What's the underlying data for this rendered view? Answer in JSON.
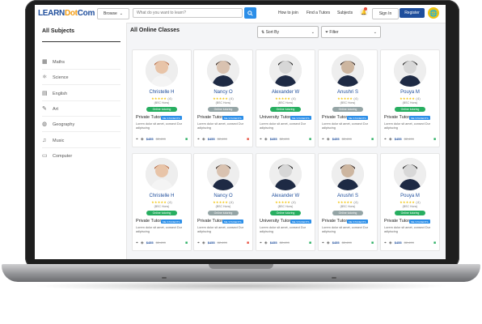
{
  "nav": {
    "logo_a": "LEARN",
    "logo_b": "Dot",
    "logo_c": "Com",
    "browse": "Browse",
    "search_placeholder": "What do you want to learn?",
    "links": [
      "How to join",
      "Find a Tutors",
      "Subjects"
    ],
    "signin": "Sign In",
    "register": "Register"
  },
  "sidebar": {
    "title": "All Subjects",
    "items": [
      {
        "label": "Maths",
        "icon": "calculator-icon"
      },
      {
        "label": "Science",
        "icon": "atom-icon"
      },
      {
        "label": "English",
        "icon": "book-icon"
      },
      {
        "label": "Art",
        "icon": "palette-icon"
      },
      {
        "label": "Geography",
        "icon": "globe-icon"
      },
      {
        "label": "Music",
        "icon": "music-note-icon"
      },
      {
        "label": "Computer",
        "icon": "monitor-icon"
      }
    ]
  },
  "main": {
    "title": "All Online Classes",
    "sort_label": "Sort By",
    "filter_label": "Filter"
  },
  "cards": [
    {
      "name": "Christelle H",
      "stars": "★★★★★",
      "score": "(4)",
      "loc": "(BSC Hons)",
      "mode": "Online tutoring",
      "mode_color": "#27ae60",
      "type": "Private Tutor",
      "badge": "ME STUDENTS",
      "desc": "Lorem dolor sit amet, consect Dur adipiscing",
      "price": "$455",
      "old": "$2,499"
    },
    {
      "name": "Nancy O",
      "stars": "★★★★★",
      "score": "(4)",
      "loc": "(BSC Hons)",
      "mode": "Online tutoring",
      "mode_color": "#95a5a6",
      "type": "Private Tutor",
      "badge": "ME STUDENTS",
      "desc": "Lorem dolor sit amet, consect Dur adipiscing",
      "price": "$455",
      "old": "$2,499"
    },
    {
      "name": "Alexander W",
      "stars": "★★★★★",
      "score": "(4)",
      "loc": "(BSC Hons)",
      "mode": "Online tutoring",
      "mode_color": "#27ae60",
      "type": "University Tutor",
      "badge": "ME STUDENTS",
      "desc": "Lorem dolor sit amet, consect Dur adipiscing",
      "price": "$455",
      "old": "$2,499"
    },
    {
      "name": "Anushri S",
      "stars": "★★★★★",
      "score": "(4)",
      "loc": "(BSC Hons)",
      "mode": "Online tutoring",
      "mode_color": "#95a5a6",
      "type": "Private Tutor",
      "badge": "ME STUDENTS",
      "desc": "Lorem dolor sit amet, consect Dur adipiscing",
      "price": "$455",
      "old": "$2,499"
    },
    {
      "name": "Pouya M",
      "stars": "★★★★★",
      "score": "(4)",
      "loc": "(BSC Hons)",
      "mode": "Online tutoring",
      "mode_color": "#27ae60",
      "type": "Private Tutor",
      "badge": "ME STUDENTS",
      "desc": "Lorem dolor sit amet, consect Dur adipiscing",
      "price": "$455",
      "old": "$2,499"
    },
    {
      "name": "Christelle H",
      "stars": "★★★★★",
      "score": "(4)",
      "loc": "(BSC Hons)",
      "mode": "Online tutoring",
      "mode_color": "#27ae60",
      "type": "Private Tutor",
      "badge": "ME STUDENTS",
      "desc": "Lorem dolor sit amet, consect Dur adipiscing",
      "price": "$455",
      "old": "$2,499"
    },
    {
      "name": "Nancy O",
      "stars": "★★★★★",
      "score": "(4)",
      "loc": "(BSC Hons)",
      "mode": "Online tutoring",
      "mode_color": "#95a5a6",
      "type": "Private Tutor",
      "badge": "ME STUDENTS",
      "desc": "Lorem dolor sit amet, consect Dur adipiscing",
      "price": "$455",
      "old": "$2,499"
    },
    {
      "name": "Alexander W",
      "stars": "★★★★★",
      "score": "(4)",
      "loc": "(BSC Hons)",
      "mode": "Online tutoring",
      "mode_color": "#27ae60",
      "type": "University Tutor",
      "badge": "ME STUDENTS",
      "desc": "Lorem dolor sit amet, consect Dur adipiscing",
      "price": "$455",
      "old": "$2,499"
    },
    {
      "name": "Anushri S",
      "stars": "★★★★★",
      "score": "(4)",
      "loc": "(BSC Hons)",
      "mode": "Online tutoring",
      "mode_color": "#95a5a6",
      "type": "Private Tutor",
      "badge": "ME STUDENTS",
      "desc": "Lorem dolor sit amet, consect Dur adipiscing",
      "price": "$455",
      "old": "$2,499"
    },
    {
      "name": "Pouya M",
      "stars": "★★★★★",
      "score": "(4)",
      "loc": "(BSC Hons)",
      "mode": "Online tutoring",
      "mode_color": "#27ae60",
      "type": "Private Tutor",
      "badge": "ME STUDENTS",
      "desc": "Lorem dolor sit amet, consect Dur adipiscing",
      "price": "$455",
      "old": "$2,499"
    }
  ]
}
